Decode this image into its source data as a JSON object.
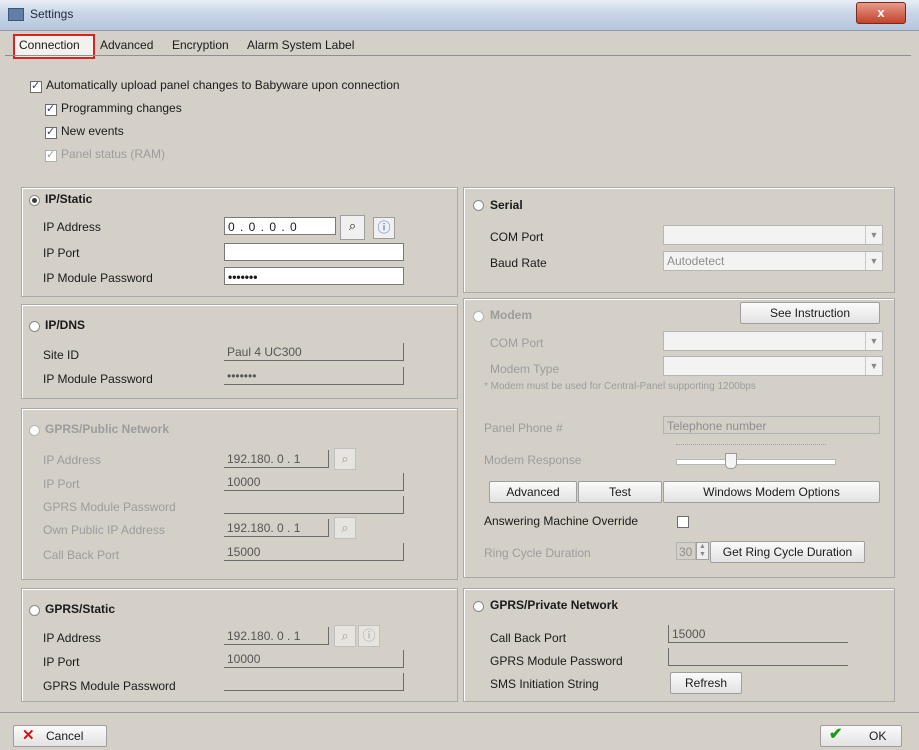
{
  "window": {
    "title": "Settings",
    "close_label": "x"
  },
  "tabs": [
    {
      "label": "Connection",
      "selected": true
    },
    {
      "label": "Advanced"
    },
    {
      "label": "Encryption"
    },
    {
      "label": "Alarm System Label"
    }
  ],
  "upload": {
    "main_label": "Automatically upload panel changes to Babyware upon connection",
    "main_checked": true,
    "programming_label": "Programming changes",
    "programming_checked": true,
    "events_label": "New events",
    "events_checked": true,
    "status_label": "Panel status (RAM)",
    "status_checked": true
  },
  "ip_static": {
    "title": "IP/Static",
    "selected": true,
    "ip_label": "IP Address",
    "ip_value": "0 . 0 . 0 . 0",
    "port_label": "IP Port",
    "port_value": "",
    "password_label": "IP Module Password",
    "password_value": "•••••••"
  },
  "ip_dns": {
    "title": "IP/DNS",
    "site_label": "Site ID",
    "site_value": "Paul 4 UC300",
    "password_label": "IP Module Password",
    "password_value": "•••••••"
  },
  "gprs_public": {
    "title": "GPRS/Public Network",
    "ip_label": "IP Address",
    "ip_value": "192.180. 0 . 1",
    "port_label": "IP Port",
    "port_value": "10000",
    "password_label": "GPRS Module Password",
    "password_value": "",
    "own_ip_label": "Own Public IP Address",
    "own_ip_value": "192.180. 0 . 1",
    "callback_label": "Call Back Port",
    "callback_value": "15000"
  },
  "gprs_static": {
    "title": "GPRS/Static",
    "ip_label": "IP Address",
    "ip_value": "192.180. 0 . 1",
    "port_label": "IP Port",
    "port_value": "10000",
    "password_label": "GPRS Module Password",
    "password_value": ""
  },
  "serial": {
    "title": "Serial",
    "com_label": "COM Port",
    "com_value": "",
    "baud_label": "Baud Rate",
    "baud_value": "Autodetect"
  },
  "modem": {
    "title": "Modem",
    "instruction_button": "See Instruction",
    "com_label": "COM Port",
    "com_value": "",
    "type_label": "Modem Type",
    "type_value": "",
    "note": "* Modem must be used for Central-Panel supporting 1200bps",
    "phone_label": "Panel Phone #",
    "phone_placeholder": "Telephone number",
    "response_label": "Modem Response",
    "response_level": 0.33,
    "advanced_button": "Advanced",
    "test_button": "Test",
    "options_button": "Windows Modem Options",
    "override_label": "Answering Machine Override",
    "override_checked": false,
    "ring_label": "Ring Cycle Duration",
    "ring_value": "30",
    "ring_button": "Get Ring Cycle Duration"
  },
  "gprs_private": {
    "title": "GPRS/Private Network",
    "callback_label": "Call Back Port",
    "callback_value": "15000",
    "password_label": "GPRS Module Password",
    "password_value": "",
    "sms_label": "SMS Initiation String",
    "refresh_button": "Refresh"
  },
  "footer": {
    "cancel_label": "Cancel",
    "ok_label": "OK"
  },
  "colors": {
    "highlight": "#e02020",
    "cancel_x": "#d01818",
    "ok_check": "#1a9a1a"
  }
}
